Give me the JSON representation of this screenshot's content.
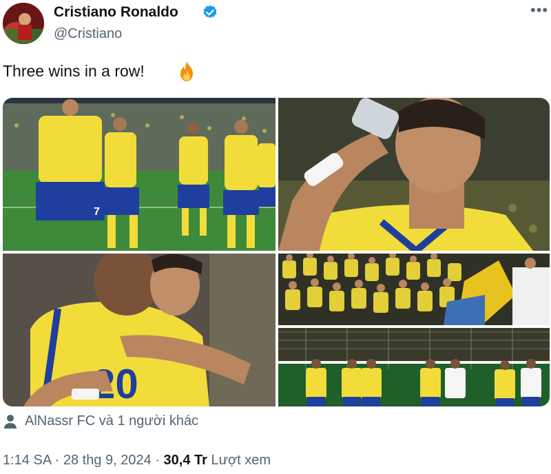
{
  "author": {
    "name": "Cristiano Ronaldo",
    "handle": "@Cristiano",
    "verified": true
  },
  "icons": {
    "verified": "verified-badge-icon",
    "more": "more-options-icon",
    "tag": "person-tag-icon",
    "emoji": "fire-emoji"
  },
  "tweet": {
    "text": "Three wins in a row!"
  },
  "media": {
    "photo_count": 5,
    "jersey_number": "7"
  },
  "tagged": {
    "text": "AlNassr FC và 1 người khác"
  },
  "meta": {
    "time": "1:14 SA",
    "separator": "·",
    "date": "28 thg 9, 2024",
    "views_value": "30,4 Tr",
    "views_label": "Lượt xem"
  },
  "colors": {
    "text": "#0f1419",
    "secondary": "#536471",
    "verified": "#1d9bf0",
    "jersey_yellow": "#f2dc3a",
    "jersey_blue": "#1f3f9e"
  }
}
